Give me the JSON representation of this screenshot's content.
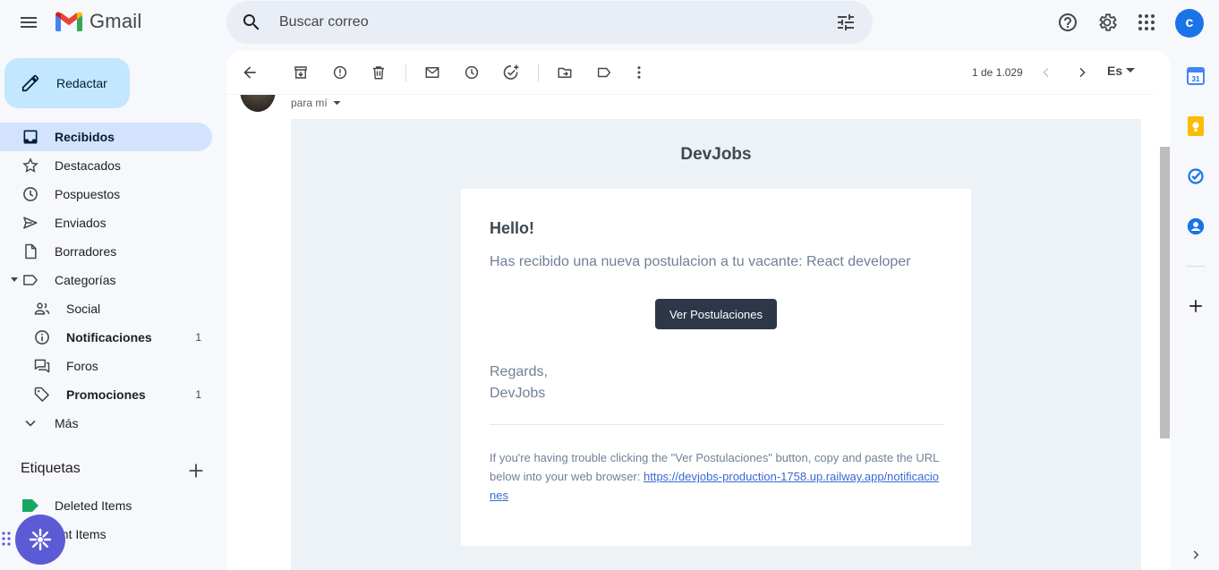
{
  "app": {
    "name": "Gmail"
  },
  "search": {
    "placeholder": "Buscar correo"
  },
  "account": {
    "initial": "c"
  },
  "compose": {
    "label": "Redactar"
  },
  "nav": {
    "inbox": {
      "label": "Recibidos"
    },
    "starred": {
      "label": "Destacados"
    },
    "snoozed": {
      "label": "Pospuestos"
    },
    "sent": {
      "label": "Enviados"
    },
    "drafts": {
      "label": "Borradores"
    },
    "categories": {
      "label": "Categorías"
    },
    "social": {
      "label": "Social"
    },
    "updates": {
      "label": "Notificaciones",
      "count": "1"
    },
    "forums": {
      "label": "Foros"
    },
    "promotions": {
      "label": "Promociones",
      "count": "1"
    },
    "more": {
      "label": "Más"
    }
  },
  "labels": {
    "heading": "Etiquetas",
    "items": [
      {
        "label": "Deleted Items",
        "color": "#16a765"
      },
      {
        "label": "ent Items"
      }
    ]
  },
  "toolbar": {
    "pager": "1 de 1.029",
    "language": "Es"
  },
  "message": {
    "recipient": "para mí",
    "brand": "DevJobs",
    "greeting": "Hello!",
    "intro": "Has recibido una nueva postulacion a tu vacante: React developer",
    "button_label": "Ver Postulaciones",
    "regards_line1": "Regards,",
    "regards_line2": "DevJobs",
    "trouble_text": "If you're having trouble clicking the \"Ver Postulaciones\" button, copy and paste the URL below into your web browser: ",
    "url": "https://devjobs-production-1758.up.railway.app/notificaciones"
  },
  "colors": {
    "accent": "#1a73e8",
    "compose_bg": "#c2e7ff",
    "active_nav": "#d3e3fd",
    "email_button": "#2d3748"
  }
}
